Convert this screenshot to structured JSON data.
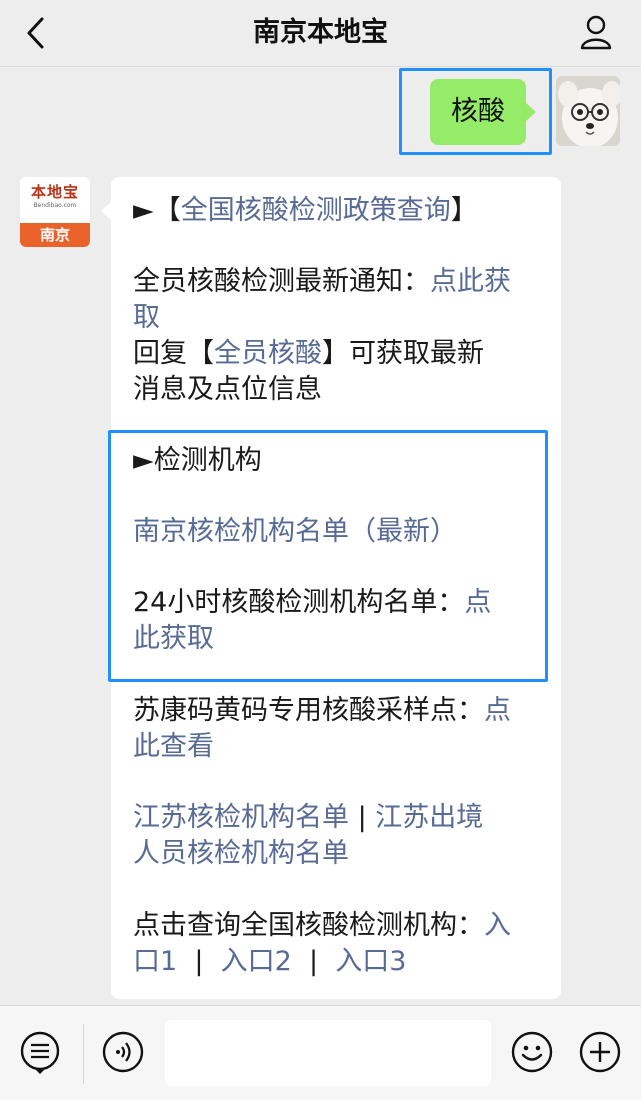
{
  "header": {
    "title": "南京本地宝"
  },
  "sent_message": {
    "text": "核酸"
  },
  "bot": {
    "avatar_brand": "本地宝",
    "avatar_sub": "Bendibao.com",
    "avatar_city": "南京"
  },
  "reply": {
    "l1_prefix": "►【",
    "l1_link": "全国核酸检测政策查询",
    "l1_suffix": "】",
    "l2_text": "全员核酸检测最新通知：",
    "l2_link_a": "点此获",
    "l2_link_b": "取",
    "l3_prefix": "回复【",
    "l3_link": "全员核酸",
    "l3_suffix": "】可获取最新",
    "l4_text": "消息及点位信息",
    "l5_text": "►检测机构",
    "l6_link": "南京核检机构名单（最新）",
    "l7_text": "24小时核酸检测机构名单：",
    "l7_link": "点",
    "l8_link": "此获取",
    "l9_text": "苏康码黄码专用核酸采样点：",
    "l9_link": "点",
    "l10_link": "此查看",
    "l11_link_a": "江苏核检机构名单",
    "l11_sep": " | ",
    "l11_link_b": "江苏出境",
    "l12_link": "人员核检机构名单",
    "l13_text": "点击查询全国核酸检测机构：",
    "l13_link": "入",
    "l14_link_a": "口1",
    "l14_sep1": "  |  ",
    "l14_link_b": "入口2",
    "l14_sep2": "  |  ",
    "l14_link_c": "入口3"
  },
  "colors": {
    "link": "#576b95",
    "sent_bubble": "#95ec69",
    "highlight": "#1e90ff",
    "brand_orange": "#e8622a"
  },
  "icons": {
    "back": "chevron-left-icon",
    "profile": "person-icon",
    "menu": "menu-list-icon",
    "voice": "voice-icon",
    "emoji": "smiley-icon",
    "plus": "plus-icon"
  }
}
